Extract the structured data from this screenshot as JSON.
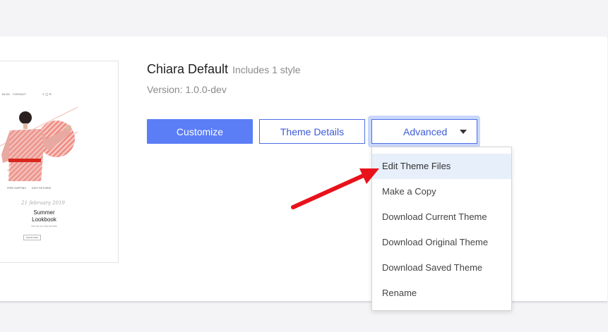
{
  "theme": {
    "name": "Chiara Default",
    "style_note": "Includes 1 style",
    "version": "Version: 1.0.0-dev"
  },
  "preview": {
    "nav_links": [
      "BLOG",
      "CONTACT"
    ],
    "features": [
      "FREE SHIPPING",
      "EASY RETURNS"
    ],
    "script_text": "21 february 2019",
    "headline_line1": "Summer",
    "headline_line2": "Lookbook",
    "subline": "See all our new arrivals",
    "cta": "SHOP NOW"
  },
  "buttons": {
    "customize": "Customize",
    "theme_details": "Theme Details",
    "advanced": "Advanced"
  },
  "advanced_menu": {
    "items": [
      "Edit Theme Files",
      "Make a Copy",
      "Download Current Theme",
      "Download Original Theme",
      "Download Saved Theme",
      "Rename"
    ],
    "highlighted_index": 0
  },
  "colors": {
    "primary": "#5b7ef7",
    "outline": "#4f6ee6",
    "annotation_arrow": "#e8121b",
    "menu_highlight": "#e6effa"
  }
}
